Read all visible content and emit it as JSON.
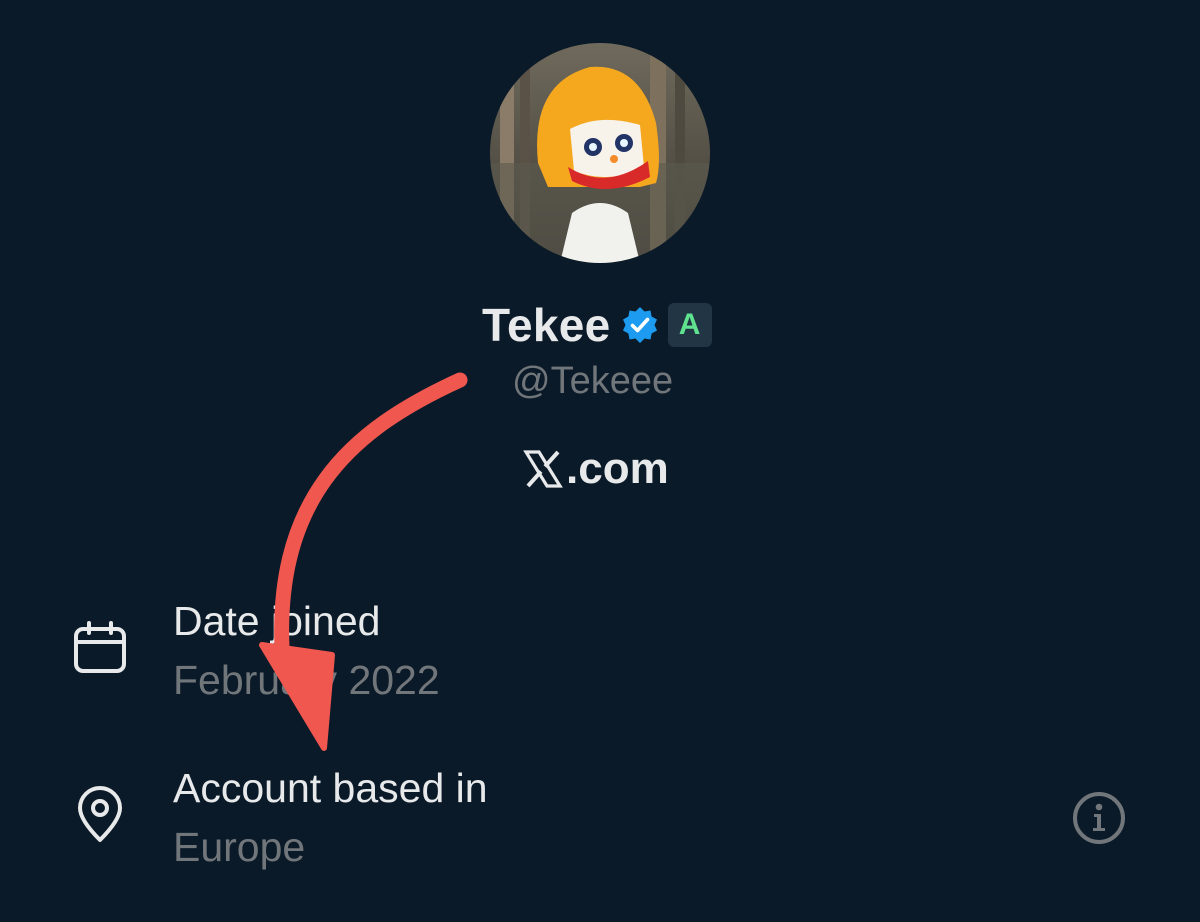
{
  "profile": {
    "display_name": "Tekee",
    "handle": "@Tekeee",
    "badge_letter": "A",
    "website": ".com",
    "avatar_icon": "cartoon-clown-avatar"
  },
  "rows": {
    "date_joined_label": "Date joined",
    "date_joined_value": "February 2022",
    "location_label": "Account based in",
    "location_value": "Europe"
  },
  "colors": {
    "background": "#0b1a28",
    "verified": "#1d9bf0",
    "badge_text": "#5fe38f",
    "annotation_arrow": "#f0574f",
    "secondary_text": "#71767b"
  }
}
